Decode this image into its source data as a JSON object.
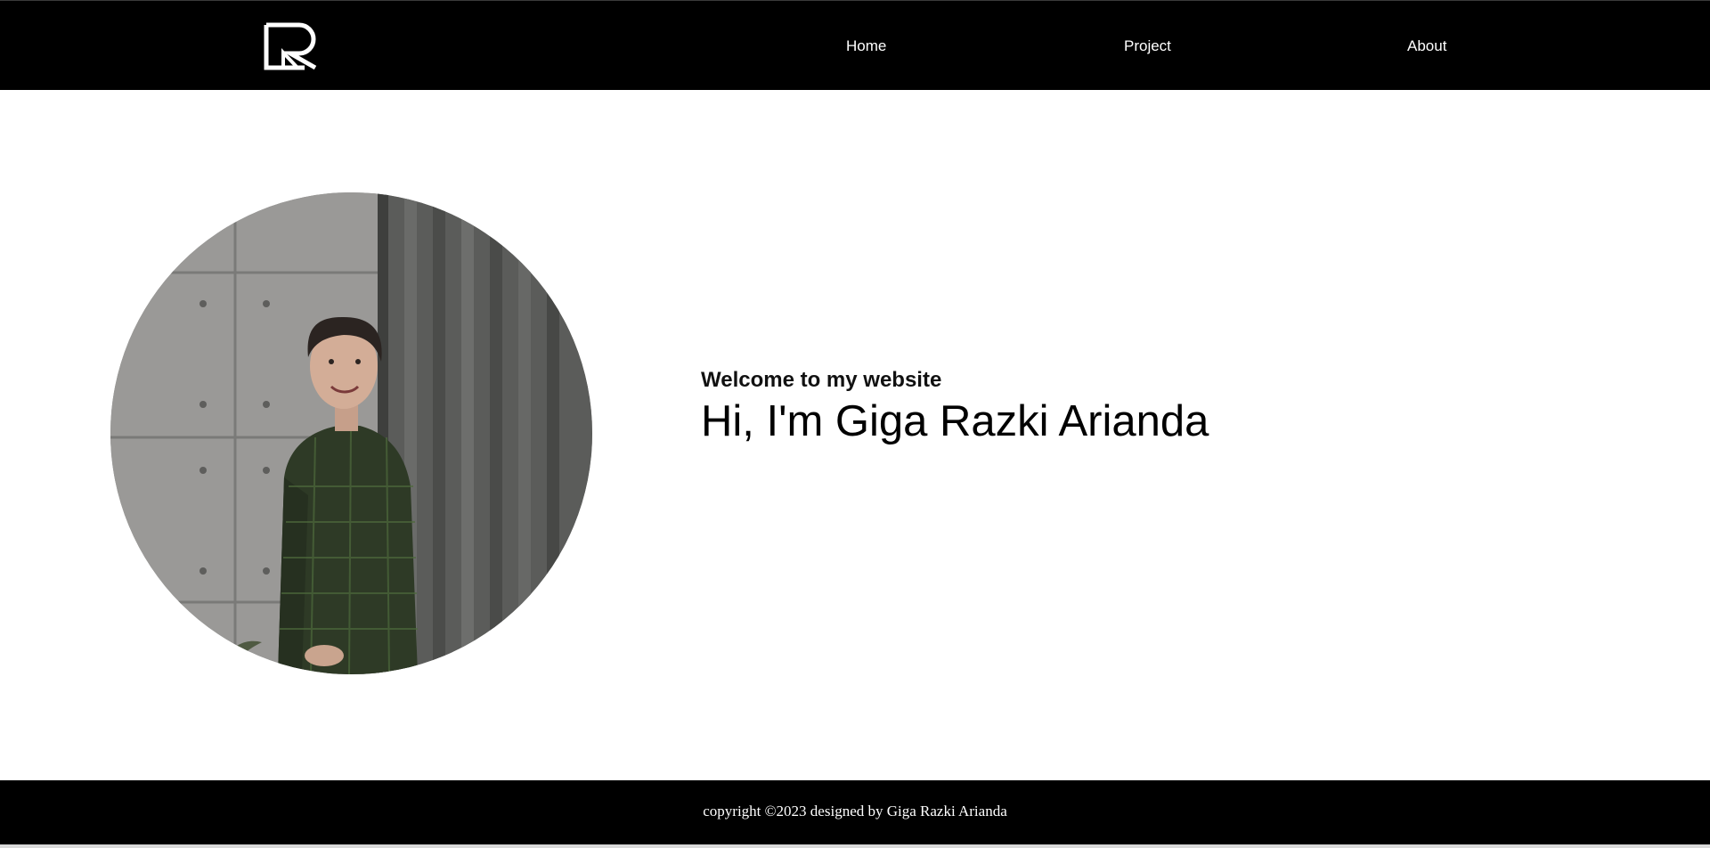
{
  "header": {
    "logo_icon": "r-monogram-logo-icon",
    "nav": [
      {
        "label": "Home"
      },
      {
        "label": "Project"
      },
      {
        "label": "About"
      }
    ]
  },
  "hero": {
    "portrait_icon": "profile-photo",
    "welcome": "Welcome to my website",
    "headline": "Hi, I'm Giga Razki Arianda"
  },
  "footer": {
    "copyright": "copyright ©2023 designed by Giga Razki Arianda"
  },
  "colors": {
    "navbar_bg": "#000000",
    "footer_bg": "#000000",
    "page_bg": "#ffffff",
    "nav_text": "#ffffff",
    "heading_text": "#000000"
  }
}
